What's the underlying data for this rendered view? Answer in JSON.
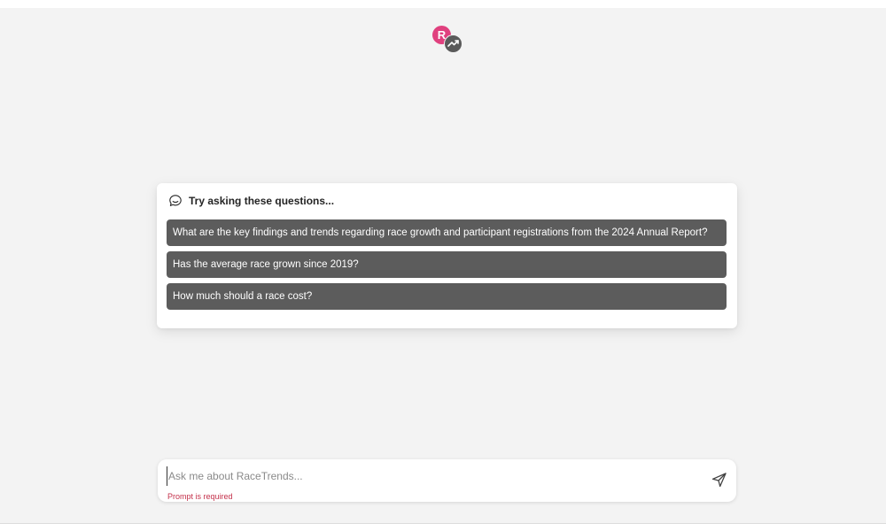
{
  "logo": {
    "letter": "R",
    "icon": "trending-up-icon",
    "colors": {
      "letter_bg": "#e0407e",
      "badge_bg": "#5a5a5a"
    }
  },
  "suggestions": {
    "icon": "chat-bubble-icon",
    "title": "Try asking these questions...",
    "items": [
      "What are the key findings and trends regarding race growth and participant registrations from the 2024 Annual Report?",
      "Has the average race grown since 2019?",
      "How much should a race cost?"
    ],
    "colors": {
      "button_bg": "#5c5c5c",
      "button_text": "#ffffff"
    }
  },
  "prompt": {
    "value": "",
    "placeholder": "Ask me about RaceTrends...",
    "error": "Prompt is required",
    "send_icon": "send-icon",
    "colors": {
      "error": "#c4314b"
    }
  }
}
